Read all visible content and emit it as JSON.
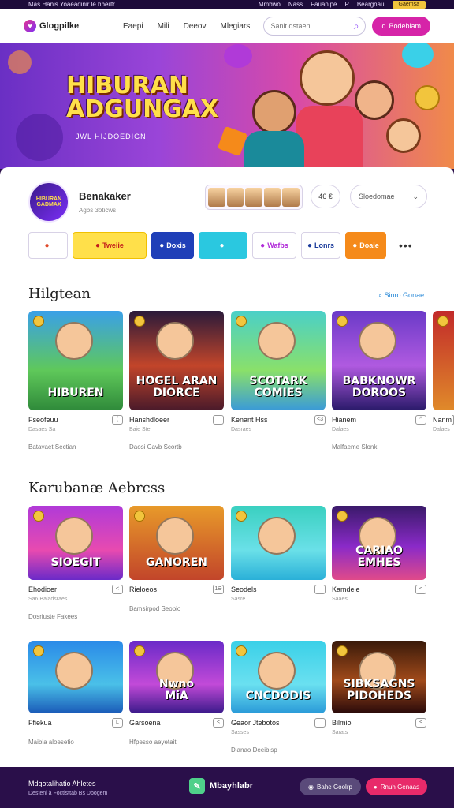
{
  "topbar": {
    "left": "Mas Hanis Yoaeadinir le hbeiltr",
    "links": [
      "Mmbwo",
      "Nass",
      "Fauanipe",
      "P",
      "Beargnau"
    ],
    "button": "Gaemsa"
  },
  "nav": {
    "brand": "Glogpilke",
    "links": [
      "Eaepi",
      "Mili",
      "Deeov",
      "Mlegiars"
    ],
    "search_placeholder": "Sanit dstaeni",
    "search_icon": "search-icon",
    "cta_label": "Bodebiam",
    "cta_icon": "d"
  },
  "hero": {
    "title_line1": "HIBURAN",
    "title_line2": "ADGUNGAX",
    "subtitle": "JWL HIJDOEDIGN"
  },
  "profile": {
    "avatar_text": "HIBURAN GADMAX",
    "name": "Benakaker",
    "sub": "Agbs 3oticws",
    "stat": "46 €",
    "sort_label": "Sloedomae",
    "sort_icon": "chevron-down-icon"
  },
  "categories": [
    {
      "label": "",
      "bg": "#ffffff",
      "fg": "#e04a2a",
      "border": "#d8d2e6",
      "w": 50
    },
    {
      "label": "Tweiie",
      "bg": "#ffe04a",
      "fg": "#c21a1a",
      "border": "#f0c000",
      "w": 94
    },
    {
      "label": "Doxis",
      "bg": "#1f3fb8",
      "fg": "#ffffff",
      "border": "#1f3fb8",
      "w": 54
    },
    {
      "label": "",
      "bg": "#2ac8e0",
      "fg": "#ffffff",
      "border": "#2ac8e0",
      "w": 62
    },
    {
      "label": "Wafbs",
      "bg": "#ffffff",
      "fg": "#b02ad8",
      "border": "#d8d2e6",
      "w": 56
    },
    {
      "label": "Lonrs",
      "bg": "#ffffff",
      "fg": "#1a3a9a",
      "border": "#d8d2e6",
      "w": 50
    },
    {
      "label": "Doaie",
      "bg": "#f58a1a",
      "fg": "#ffffff",
      "border": "#f58a1a",
      "w": 52
    }
  ],
  "section1": {
    "title": "Hilgtean",
    "see_all": "Sinro Gonae",
    "cards": [
      {
        "title": "HIBUREN",
        "name": "Fseofeuu",
        "meta": "Dasaes Sa",
        "foot": "Batavaet Sectian",
        "icon": "(",
        "grad": "linear-gradient(180deg,#3aa0e8 0%,#5fc85a 60%,#2f8a3a 100%)"
      },
      {
        "title": "HOGEL ARAN\nDIORCE",
        "name": "Hanshdloeer",
        "meta": "Baie Ste",
        "foot": "Daosi Cavb Scortb",
        "icon": "",
        "grad": "linear-gradient(180deg,#2a1a3a 0%,#c2452a 55%,#4a1a2a 100%)"
      },
      {
        "title": "SCOTARK\nCOMIES",
        "name": "Kenant Hss",
        "meta": "Dasraes",
        "foot": "",
        "icon": "<3",
        "grad": "linear-gradient(180deg,#4ad0c8 0%,#8ae06a 60%,#3a9ad8 100%)"
      },
      {
        "title": "BABKNOWR\nDOROOS",
        "name": "Hianem",
        "meta": "Dalaes",
        "foot": "Malfaeme Slonk",
        "icon": "^",
        "grad": "linear-gradient(180deg,#6a3ac8 0%,#b05ae0 55%,#2a1a6a 100%)"
      },
      {
        "title": "",
        "name": "Nanm",
        "meta": "Dalaes",
        "foot": "",
        "icon": "",
        "grad": "linear-gradient(180deg,#c22a2a 0%,#e08a2a 100%)"
      }
    ]
  },
  "section2": {
    "title": "Karubanæ Aebrcss",
    "cards": [
      {
        "title": "SIOEGIT",
        "name": "Ehodioer",
        "meta": "Sa6 Baiadsraes",
        "foot": "Dosriuste Fakees",
        "icon": "<",
        "grad": "linear-gradient(180deg,#b03ad8 0%,#e84ab0 60%,#6a2ac8 100%)"
      },
      {
        "title": "GANOREN",
        "name": "Rieloeos",
        "meta": "",
        "foot": "Bamsirpod Seobio",
        "icon": "1Ə",
        "grad": "linear-gradient(180deg,#e89a2a 0%,#c2452a 100%)"
      },
      {
        "title": "",
        "name": "Seodels",
        "meta": "Sasre",
        "foot": "",
        "icon": "",
        "grad": "linear-gradient(180deg,#3ad0c0 0%,#6ae0e8 60%,#2ab0d8 100%)"
      },
      {
        "title": "CARIAO\nEMHES",
        "name": "Kamdeie",
        "meta": "Saaes",
        "foot": "",
        "icon": "<",
        "grad": "linear-gradient(180deg,#3a1a6a 0%,#8a2ac8 55%,#e04a8a 100%)"
      }
    ]
  },
  "section3": {
    "cards": [
      {
        "title": "",
        "name": "Ffiekua",
        "meta": "",
        "foot": "Maibla aloesetio",
        "icon": "L",
        "grad": "linear-gradient(180deg,#2a8ae8 0%,#4ac0e8 60%,#1a5ab8 100%)"
      },
      {
        "title": "Nwno\nMiA",
        "name": "Garsoena",
        "meta": "",
        "foot": "Hfpesso aeyetaiti",
        "icon": "<",
        "grad": "linear-gradient(180deg,#6a2ac8 0%,#c24ad8 60%,#3a1a8a 100%)"
      },
      {
        "title": "CNCDODIS",
        "name": "Geaor Jtebotos",
        "meta": "Sasses",
        "foot": "Dianao Deeibisp",
        "icon": "",
        "grad": "linear-gradient(180deg,#3ad0e8 0%,#6ae0f0 60%,#2a9ad8 100%)"
      },
      {
        "title": "SIBKSAGNS\nPIDOHEDS",
        "name": "Bilmio",
        "meta": "Sarats",
        "foot": "",
        "icon": "<",
        "grad": "linear-gradient(180deg,#3a1a0a 0%,#a04a1a 55%,#2a0a0a 100%)"
      }
    ]
  },
  "footer": {
    "title": "Mdgotalihatio Ahletes",
    "sub": "Desteni à Foctisttab Bs Dbogem",
    "app_label": "Mbayhlabr",
    "btn1": "Bahe Goolrp",
    "btn2": "Rnuh Genaas"
  }
}
